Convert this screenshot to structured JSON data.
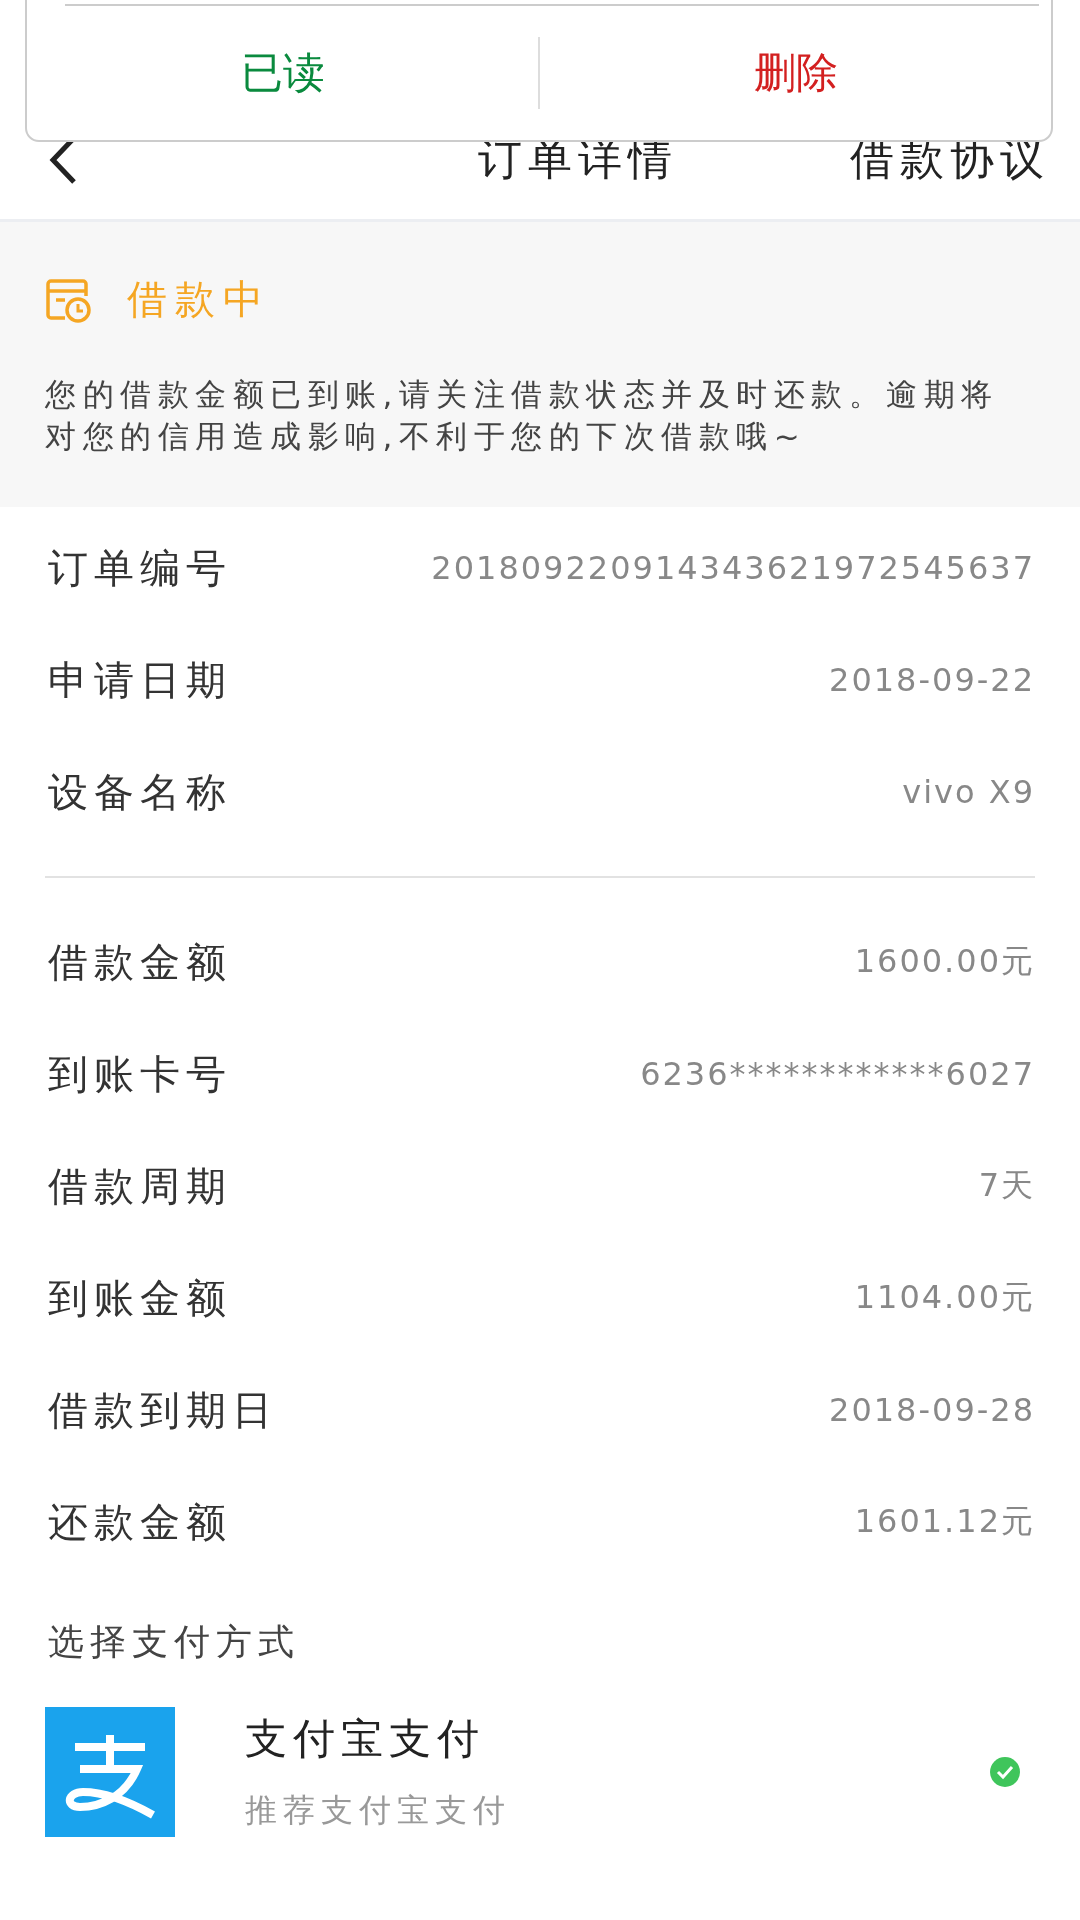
{
  "popup": {
    "buttons": [
      {
        "label": "已读",
        "kind": "read"
      },
      {
        "label": "删除",
        "kind": "delete"
      }
    ]
  },
  "header": {
    "title": "订单详情",
    "action": "借款协议"
  },
  "status": {
    "label": "借款中",
    "message": "您的借款金额已到账,请关注借款状态并及时还款。逾期将对您的信用造成影响,不利于您的下次借款哦~"
  },
  "groups": [
    [
      {
        "label": "订单编号",
        "value": "201809220914343621972545637"
      },
      {
        "label": "申请日期",
        "value": "2018-09-22"
      },
      {
        "label": "设备名称",
        "value": "vivo X9"
      }
    ],
    [
      {
        "label": "借款金额",
        "value": "1600.00元"
      },
      {
        "label": "到账卡号",
        "value": "6236************6027"
      },
      {
        "label": "借款周期",
        "value": "7天"
      },
      {
        "label": "到账金额",
        "value": "1104.00元"
      },
      {
        "label": "借款到期日",
        "value": "2018-09-28"
      },
      {
        "label": "还款金额",
        "value": "1601.12元"
      }
    ]
  ],
  "payment": {
    "heading": "选择支付方式",
    "methods": [
      {
        "name": "支付宝支付",
        "note": "推荐支付宝支付",
        "selected": true
      }
    ]
  }
}
